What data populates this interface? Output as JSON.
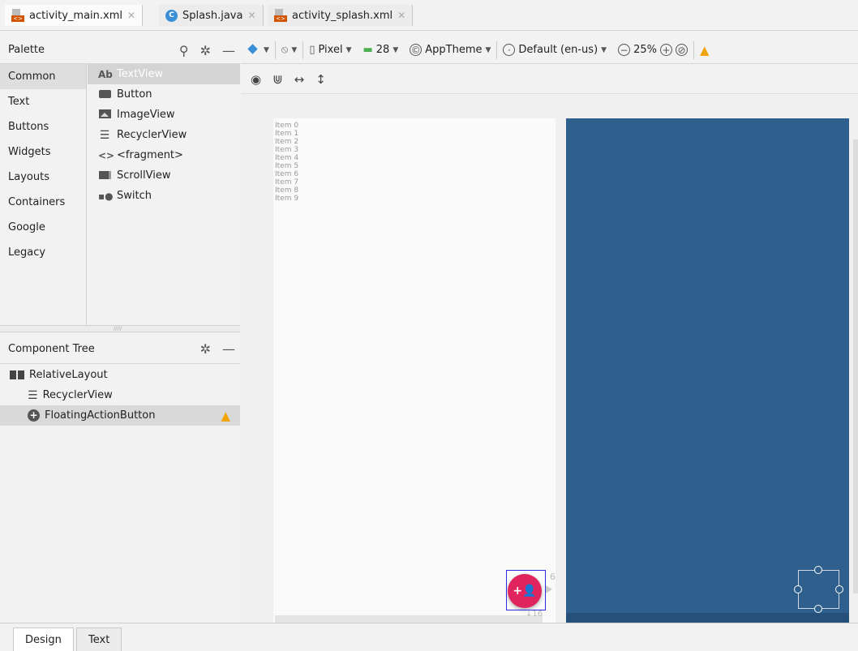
{
  "tabs": [
    {
      "label": "activity_main.xml",
      "icon": "xml-file-icon"
    },
    {
      "label": "Splash.java",
      "icon": "java-class-icon"
    },
    {
      "label": "activity_splash.xml",
      "icon": "xml-file-icon"
    }
  ],
  "palette": {
    "title": "Palette",
    "categories": [
      "Common",
      "Text",
      "Buttons",
      "Widgets",
      "Layouts",
      "Containers",
      "Google",
      "Legacy"
    ],
    "widgets": [
      {
        "icon": "Ab",
        "label": "TextView"
      },
      {
        "icon": "button-icon",
        "label": "Button"
      },
      {
        "icon": "image-icon",
        "label": "ImageView"
      },
      {
        "icon": "list-icon",
        "label": "RecyclerView"
      },
      {
        "icon": "<>",
        "label": "<fragment>"
      },
      {
        "icon": "scrollview-icon",
        "label": "ScrollView"
      },
      {
        "icon": "switch-icon",
        "label": "Switch"
      }
    ]
  },
  "component_tree": {
    "title": "Component Tree",
    "nodes": [
      "RelativeLayout",
      "RecyclerView",
      "FloatingActionButton"
    ]
  },
  "toolbar": {
    "device": "Pixel",
    "api": "28",
    "theme": "AppTheme",
    "locale": "Default (en-us)",
    "zoom": "25%"
  },
  "canvas": {
    "items": [
      "Item 0",
      "Item 1",
      "Item 2",
      "Item 3",
      "Item 4",
      "Item 5",
      "Item 6",
      "Item 7",
      "Item 8",
      "Item 9"
    ],
    "margin_right": "6",
    "margin_bottom": "16",
    "blueprint_color": "#2e5f8d",
    "fab_color": "#e0245e"
  },
  "bottom_tabs": [
    "Design",
    "Text"
  ]
}
